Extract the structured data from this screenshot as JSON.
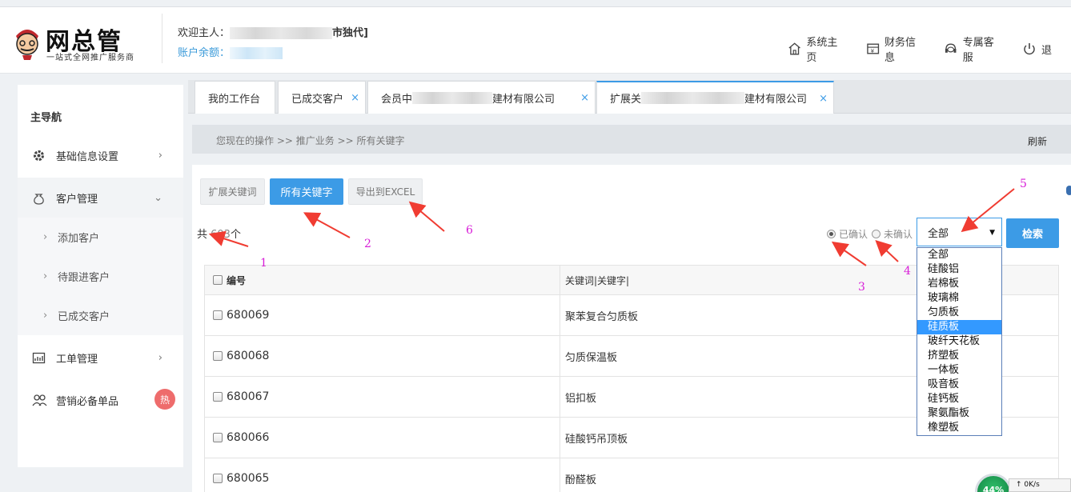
{
  "header": {
    "brand": "网总管",
    "slogan": "一站式全网推广服务商",
    "welcome_prefix": "欢迎主人：",
    "welcome_suffix": "市独代]",
    "balance_label": "账户余额："
  },
  "topnav": [
    {
      "label": "系统主页",
      "icon": "home-icon"
    },
    {
      "label": "财务信息",
      "icon": "finance-icon"
    },
    {
      "label": "专属客服",
      "icon": "headset-icon"
    },
    {
      "label": "退",
      "icon": "power-icon"
    }
  ],
  "sidebar": {
    "title": "主导航",
    "items": [
      {
        "label": "基础信息设置",
        "icon": "gear-icon"
      },
      {
        "label": "客户管理",
        "icon": "money-bag-icon"
      },
      {
        "label": "添加客户"
      },
      {
        "label": "待跟进客户"
      },
      {
        "label": "已成交客户"
      },
      {
        "label": "工单管理",
        "icon": "chart-icon"
      },
      {
        "label": "营销必备单品",
        "icon": "people-icon",
        "badge": "热"
      }
    ]
  },
  "tabs": [
    {
      "label": "我的工作台"
    },
    {
      "label": "已成交客户"
    },
    {
      "prefix": "会员中",
      "suffix": "建材有限公司"
    },
    {
      "prefix": "扩展关",
      "suffix": "建材有限公司"
    }
  ],
  "tab_close": "×",
  "breadcrumb": "您现在的操作 >> 推广业务 >> 所有关键字",
  "refresh": "刷新",
  "toolbar": {
    "expand": "扩展关键词",
    "all": "所有关键字",
    "export": "导出到EXCEL"
  },
  "total": {
    "prefix": "共 ",
    "count": "603",
    "suffix": "个"
  },
  "filters": {
    "confirmed": "已确认",
    "unconfirmed": "未确认"
  },
  "select": {
    "selected": "全部",
    "options": [
      "全部",
      "硅酸铝",
      "岩棉板",
      "玻璃棉",
      "匀质板",
      "硅质板",
      "玻纤天花板",
      "挤塑板",
      "一体板",
      "吸音板",
      "硅钙板",
      "聚氨酯板",
      "橡塑板"
    ],
    "highlighted_index": 5
  },
  "search_button": "检索",
  "table": {
    "headers": [
      "编号",
      "关键词|关键字|"
    ],
    "rows": [
      {
        "id": "680069",
        "keyword": "聚苯复合匀质板"
      },
      {
        "id": "680068",
        "keyword": "匀质保温板"
      },
      {
        "id": "680067",
        "keyword": "铝扣板"
      },
      {
        "id": "680066",
        "keyword": "硅酸钙吊顶板"
      },
      {
        "id": "680065",
        "keyword": "酚醛板"
      }
    ]
  },
  "annotations": [
    "1",
    "2",
    "3",
    "4",
    "5",
    "6"
  ],
  "speed_widget": {
    "percent": "44%",
    "rate": "0K/s"
  },
  "colors": {
    "accent": "#3c9be6",
    "annotation": "#d81ed8",
    "arrow": "#f03c32",
    "badge": "#ee6c6c"
  }
}
